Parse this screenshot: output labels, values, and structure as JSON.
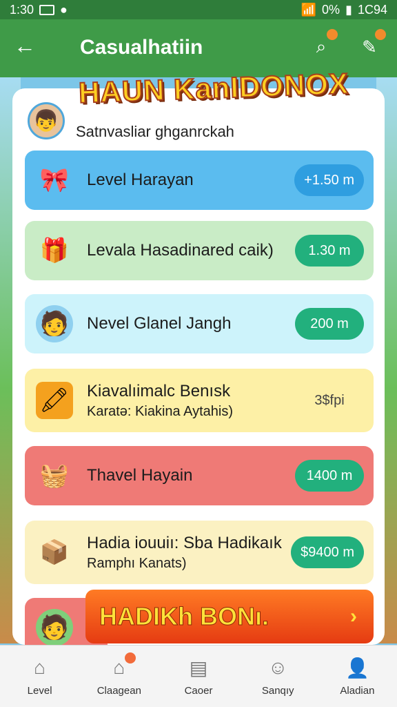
{
  "status_bar": {
    "time": "1:30",
    "battery": "0%",
    "right_text": "1C94"
  },
  "app_bar": {
    "title": "Casualhatiin",
    "back_icon": "←",
    "search_icon": "⌕",
    "edit_icon": "✎"
  },
  "banner": {
    "text": "HAUN KanIDONOX"
  },
  "profile": {
    "subtitle": "Satnvasliar ghganrckah",
    "avatar_icon": "👦"
  },
  "cards": [
    {
      "title": "Level Harayan",
      "subtitle": "",
      "value": "+1.50 m",
      "icon": "🎀",
      "bg": "#5bbcef",
      "pill": "#2f9ee0"
    },
    {
      "title": "Levala Hasadinared caik)",
      "subtitle": "",
      "value": "1.30 m",
      "icon": "🎁",
      "bg": "#c9ecc6",
      "pill": "#22b07d"
    },
    {
      "title": "Nevel Glanel Jangh",
      "subtitle": "",
      "value": "200 m",
      "icon": "🧑",
      "bg": "#cdf3fb",
      "pill": "#22b07d"
    },
    {
      "title": "Kiavalıimalc Benısk",
      "subtitle": "Karatə: Kiakina Aytahis)",
      "value": "3$fpi",
      "icon": "🖍",
      "bg": "#fdf0a6",
      "pill": ""
    },
    {
      "title": "Thavel Hayain",
      "subtitle": "",
      "value": "1400 m",
      "icon": "🧺",
      "bg": "#ef7a76",
      "pill": "#22b07d"
    },
    {
      "title": "Hadia iouuiı: Sba Hadikaık",
      "subtitle": "Ramphı Kanats)",
      "value": "$9400 m",
      "icon": "📦",
      "bg": "#fbf1c2",
      "pill": "#22b07d"
    }
  ],
  "bonus": {
    "label": "HADIKh BONı.",
    "arrow": "›"
  },
  "bottom_nav": [
    {
      "label": "Level",
      "icon": "⌂"
    },
    {
      "label": "Claagean",
      "icon": "⌂"
    },
    {
      "label": "Caoer",
      "icon": "▤"
    },
    {
      "label": "Sanqıy",
      "icon": "☺"
    },
    {
      "label": "Aladian",
      "icon": "👤"
    }
  ]
}
